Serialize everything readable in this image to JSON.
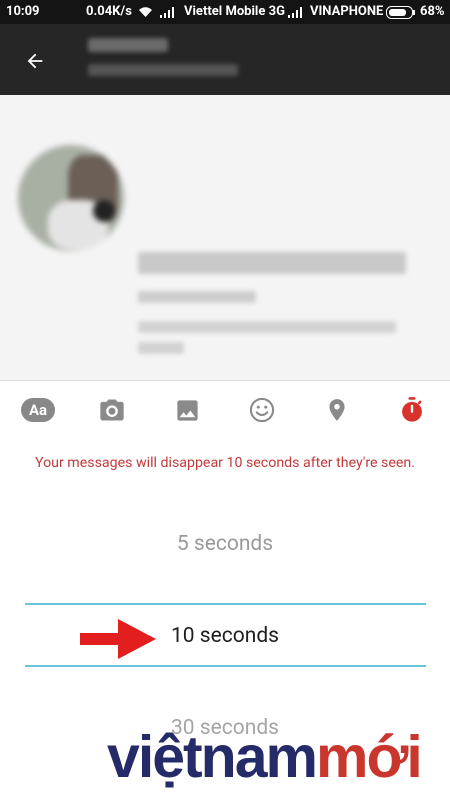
{
  "status_bar": {
    "time": "10:09",
    "speed": "0.04K/s",
    "carrier1": "Viettel Mobile 3G",
    "carrier2": "VINAPHONE",
    "battery": "68%"
  },
  "toolbar": {
    "text_button_label": "Aa"
  },
  "notice": "Your messages will disappear 10 seconds after they're seen.",
  "timer_options": {
    "above": "5 seconds",
    "selected": "10 seconds",
    "below": "30 seconds"
  },
  "watermark": {
    "part1": "việt",
    "part2": "nam",
    "part3": "mới"
  },
  "colors": {
    "accent_red": "#d8322c",
    "selection_line": "#68c4dc",
    "watermark_navy": "#252a69",
    "watermark_red": "#c8362e"
  }
}
